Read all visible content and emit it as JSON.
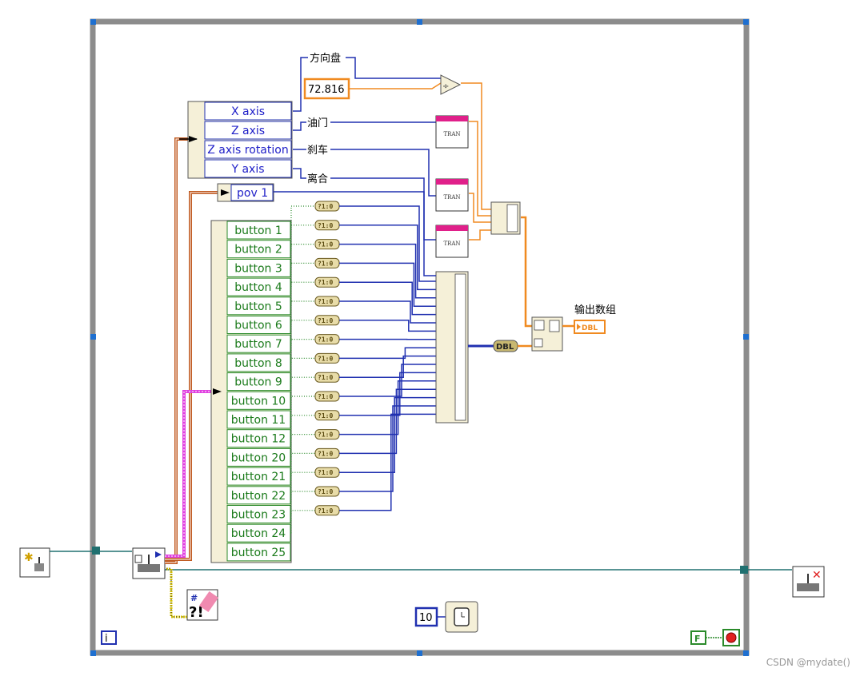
{
  "cluster_x": {
    "labels": [
      "X axis",
      "Z axis",
      "Z axis rotation",
      "Y axis"
    ]
  },
  "pov_label": "pov 1",
  "outputs": {
    "steering": "方向盘",
    "throttle": "油门",
    "brake": "刹车",
    "clutch": "离合"
  },
  "constant_value": "72.816",
  "buttons": [
    "button 1",
    "button 2",
    "button 3",
    "button 4",
    "button 5",
    "button 6",
    "button 7",
    "button 8",
    "button 9",
    "button 10",
    "button 11",
    "button 12",
    "button 20",
    "button 21",
    "button 22",
    "button 23",
    "button 24",
    "button 25"
  ],
  "select_label": "?1:0",
  "tran_label": "TRAN",
  "dbl_label": "DBL",
  "output_array_label": "输出数组",
  "wait_value": "10",
  "loop_index": "i",
  "stop_const": "F",
  "watermark": "CSDN @mydate()",
  "colors": {
    "loop_frame": "#8c8c8c",
    "cluster_wire": "#c05a20",
    "boolean_wire": "#2a8a2a",
    "numeric_wire": "#2030b0",
    "dbl_wire": "#f08a20",
    "refnum_wire": "#207070",
    "error_wire": "#d4c000",
    "pink_wire": "#e040e0"
  }
}
